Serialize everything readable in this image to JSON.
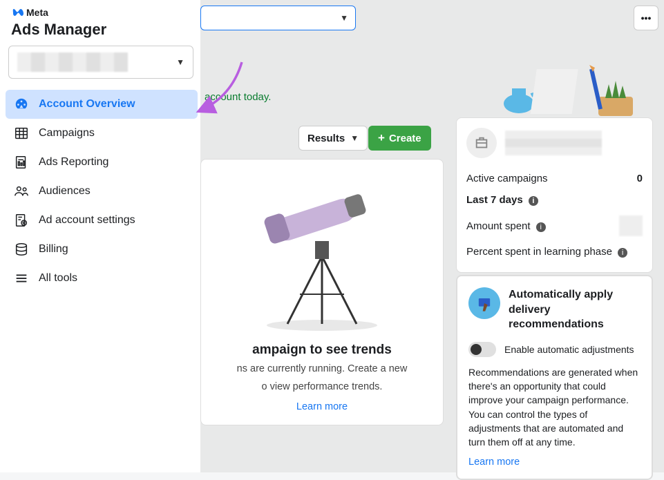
{
  "brand": {
    "meta": "Meta"
  },
  "app_title": "Ads Manager",
  "nav": {
    "overview": "Account Overview",
    "campaigns": "Campaigns",
    "reporting": "Ads Reporting",
    "audiences": "Audiences",
    "settings": "Ad account settings",
    "billing": "Billing",
    "alltools": "All tools"
  },
  "banner_text": "account today.",
  "results_label": "Results",
  "create_label": "Create",
  "empty": {
    "title": "ampaign to see trends",
    "sub1": "ns are currently running. Create a new",
    "sub2": "o view performance trends.",
    "learn_more": "Learn more"
  },
  "stats": {
    "active_campaigns_label": "Active campaigns",
    "active_campaigns_value": "0",
    "last7": "Last 7 days",
    "amount_spent": "Amount spent",
    "percent_learning": "Percent spent in learning phase"
  },
  "recs": {
    "title": "Automatically apply delivery recommendations",
    "toggle_label": "Enable automatic adjustments",
    "desc": "Recommendations are generated when there's an opportunity that could improve your campaign performance. You can control the types of adjustments that are automated and turn them off at any time.",
    "learn_more": "Learn more"
  }
}
